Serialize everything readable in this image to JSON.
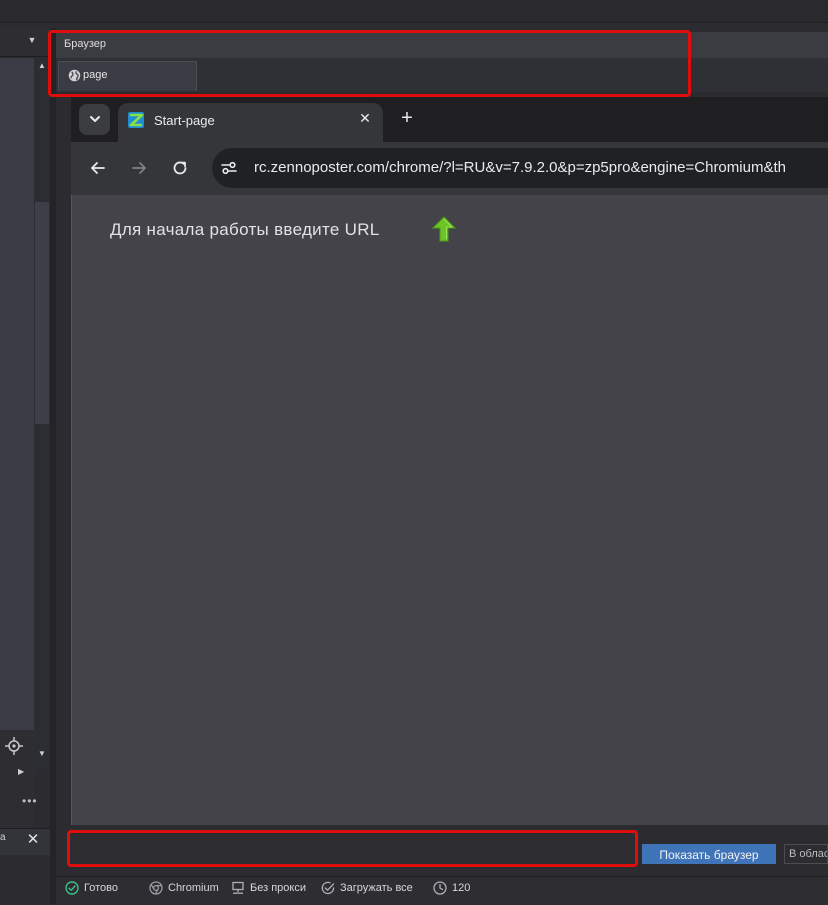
{
  "panel": {
    "title": "Браузер",
    "tab_label": "page"
  },
  "browser": {
    "tab_title": "Start-page",
    "url": "rc.zennoposter.com/chrome/?l=RU&v=7.9.2.0&p=zp5pro&engine=Chromium&th",
    "start_message": "Для начала работы введите URL"
  },
  "bottom": {
    "url_input_value": "",
    "show_browser_label": "Показать браузер",
    "area_label": "В облас"
  },
  "status": {
    "ready": "Готово",
    "engine": "Chromium",
    "proxy": "Без прокси",
    "load": "Загружать все",
    "timeout": "120"
  },
  "left": {
    "corner_label": "а"
  },
  "icons": {
    "globe": "globe-icon",
    "favicon": "zennoposter-favicon",
    "target": "crosshair-icon",
    "arrow_up": "green-arrow-up-icon"
  },
  "colors": {
    "highlight": "#e00d0d",
    "accent_button": "#3f74b8",
    "ready_icon": "#3cc08a",
    "arrow": "#6cc524"
  }
}
